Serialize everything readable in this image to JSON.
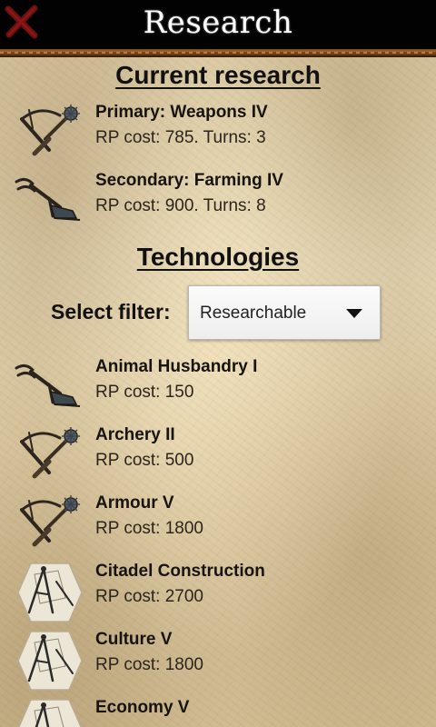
{
  "window": {
    "title": "Research"
  },
  "current_research": {
    "heading": "Current research",
    "items": [
      {
        "name": "Primary: Weapons IV",
        "cost": "RP cost: 785. Turns: 3",
        "icon": "crossbow-mace-icon"
      },
      {
        "name": "Secondary: Farming IV",
        "cost": "RP cost: 900. Turns: 8",
        "icon": "plough-icon"
      }
    ]
  },
  "technologies": {
    "heading": "Technologies",
    "filter_label": "Select filter:",
    "filter_value": "Researchable",
    "items": [
      {
        "name": "Animal Husbandry I",
        "cost": "RP cost: 150",
        "icon": "plough-icon"
      },
      {
        "name": "Archery II",
        "cost": "RP cost: 500",
        "icon": "crossbow-mace-icon"
      },
      {
        "name": "Armour V",
        "cost": "RP cost: 1800",
        "icon": "crossbow-mace-icon"
      },
      {
        "name": "Citadel Construction",
        "cost": "RP cost: 2700",
        "icon": "compass-blueprint-icon"
      },
      {
        "name": "Culture V",
        "cost": "RP cost: 1800",
        "icon": "compass-blueprint-icon"
      },
      {
        "name": "Economy V",
        "cost": "",
        "icon": "compass-blueprint-icon"
      }
    ]
  },
  "colors": {
    "close": "#6e0f0f",
    "title_bar": "#020202",
    "parchment": "#dccaa2"
  }
}
